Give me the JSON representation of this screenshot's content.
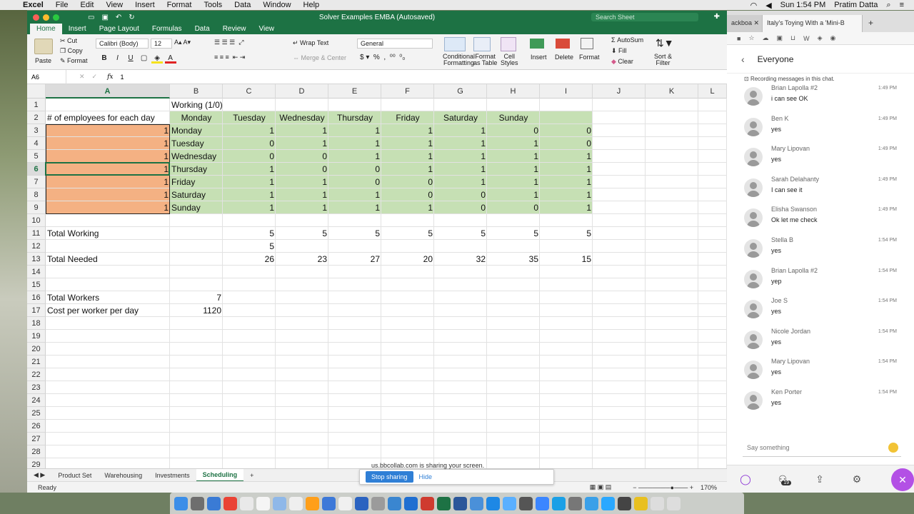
{
  "menubar": {
    "apple": "",
    "items": [
      "Excel",
      "File",
      "Edit",
      "View",
      "Insert",
      "Format",
      "Tools",
      "Data",
      "Window",
      "Help"
    ],
    "clock": "Sun 1:54 PM",
    "user": "Pratim Datta"
  },
  "excel": {
    "title": "Solver Examples EMBA  (Autosaved)",
    "search_placeholder": "Search Sheet",
    "tabs": [
      "Home",
      "Insert",
      "Page Layout",
      "Formulas",
      "Data",
      "Review",
      "View"
    ],
    "ribbon": {
      "paste": "Paste",
      "cut": "Cut",
      "copy": "Copy",
      "format": "Format",
      "font": "Calibri (Body)",
      "size": "12",
      "wrap": "Wrap Text",
      "merge": "Merge & Center",
      "number_format": "General",
      "cond_fmt_1": "Conditional",
      "cond_fmt_2": "Formatting",
      "fmt_table_1": "Format",
      "fmt_table_2": "as Table",
      "cell_styles_1": "Cell",
      "cell_styles_2": "Styles",
      "insert": "Insert",
      "delete": "Delete",
      "format_cells": "Format",
      "autosum": "AutoSum",
      "fill": "Fill",
      "clear": "Clear",
      "sort_1": "Sort &",
      "sort_2": "Filter"
    },
    "namebox": "A6",
    "formula": "1",
    "columns": [
      "A",
      "B",
      "C",
      "D",
      "E",
      "F",
      "G",
      "H",
      "I",
      "J",
      "K",
      "L"
    ],
    "rows": [
      "1",
      "2",
      "3",
      "4",
      "5",
      "6",
      "7",
      "8",
      "9",
      "10",
      "11",
      "12",
      "13",
      "14",
      "15",
      "16",
      "17",
      "18",
      "19",
      "20",
      "21",
      "22",
      "23",
      "24",
      "25",
      "26",
      "27",
      "28",
      "29"
    ],
    "b1": "Working  (1/0)",
    "a2": "# of employees for each day",
    "day_headers": [
      "Monday",
      "Tuesday",
      "Wednesday",
      "Thursday",
      "Friday",
      "Saturday",
      "Sunday"
    ],
    "days": [
      "Monday",
      "Tuesday",
      "Wednesday",
      "Thursday",
      "Friday",
      "Saturday",
      "Sunday"
    ],
    "employees": [
      "1",
      "1",
      "1",
      "1",
      "1",
      "1",
      "1"
    ],
    "matrix": [
      [
        "1",
        "1",
        "1",
        "1",
        "1",
        "0",
        "0"
      ],
      [
        "0",
        "1",
        "1",
        "1",
        "1",
        "1",
        "0"
      ],
      [
        "0",
        "0",
        "1",
        "1",
        "1",
        "1",
        "1"
      ],
      [
        "1",
        "0",
        "0",
        "1",
        "1",
        "1",
        "1"
      ],
      [
        "1",
        "1",
        "0",
        "0",
        "1",
        "1",
        "1"
      ],
      [
        "1",
        "1",
        "1",
        "0",
        "0",
        "1",
        "1"
      ],
      [
        "1",
        "1",
        "1",
        "1",
        "0",
        "0",
        "1"
      ]
    ],
    "total_working_label": "Total Working",
    "total_working": [
      "5",
      "5",
      "5",
      "5",
      "5",
      "5",
      "5"
    ],
    "c12": "5",
    "total_needed_label": "Total Needed",
    "total_needed": [
      "26",
      "23",
      "27",
      "20",
      "32",
      "35",
      "15"
    ],
    "total_workers_label": "Total Workers",
    "total_workers": "7",
    "cost_label": "Cost per worker per day",
    "cost": "1120",
    "sheet_tabs": [
      "Product Set",
      "Warehousing",
      "Investments",
      "Scheduling"
    ],
    "status": "Ready",
    "zoom": "170%",
    "share_msg": "us.bbcollab.com is sharing your screen.",
    "stop_sharing": "Stop sharing",
    "hide": "Hide"
  },
  "browser": {
    "tabs": [
      "ackboa",
      "Italy's Toying With a 'Mini-B"
    ],
    "chat_title": "Everyone",
    "recording_note": "Recording messages in this chat.",
    "messages": [
      {
        "name": "Brian Lapolla #2",
        "text": "i can see OK",
        "time": "1:49 PM"
      },
      {
        "name": "Ben K",
        "text": "yes",
        "time": "1:49 PM"
      },
      {
        "name": "Mary Lipovan",
        "text": "yes",
        "time": "1:49 PM"
      },
      {
        "name": "Sarah Delahanty",
        "text": "I can see it",
        "time": "1:49 PM"
      },
      {
        "name": "Elisha Swanson",
        "text": "Ok let me check",
        "time": "1:49 PM"
      },
      {
        "name": "Stella B",
        "text": "yes",
        "time": "1:54 PM"
      },
      {
        "name": "Brian Lapolla #2",
        "text": "yep",
        "time": "1:54 PM"
      },
      {
        "name": "Joe S",
        "text": "yes",
        "time": "1:54 PM"
      },
      {
        "name": "Nicole Jordan",
        "text": "yes",
        "time": "1:54 PM"
      },
      {
        "name": "Mary Lipovan",
        "text": "yes",
        "time": "1:54 PM"
      },
      {
        "name": "Ken Porter",
        "text": "yes",
        "time": "1:54 PM"
      }
    ],
    "say_placeholder": "Say something",
    "participants_count": "19"
  },
  "colors": {
    "excel_green": "#1d7244",
    "orange_fill": "#f4b183",
    "green_fill": "#c6e0b4",
    "collab_purple": "#b350e5"
  }
}
